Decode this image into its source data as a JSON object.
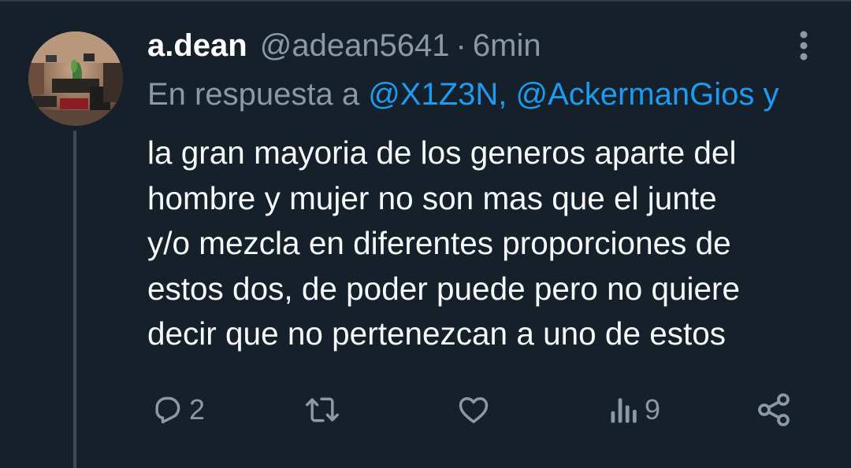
{
  "tweet": {
    "display_name": "a.dean",
    "handle": "@adean5641",
    "separator": "·",
    "time": "6min",
    "reply_prefix": "En respuesta a",
    "reply_mentions": "@X1Z3N, @AckermanGios y ",
    "body_lines": [
      "la gran mayoria de los generos aparte del",
      "hombre y mujer no son mas que el junte",
      "y/o mezcla en diferentes proporciones de",
      "estos dos, de poder puede pero no quiere",
      "decir que no pertenezcan a uno de estos"
    ]
  },
  "actions": {
    "reply_count": "2",
    "retweet_count": "",
    "like_count": "",
    "views_count": "9"
  },
  "icons": {
    "reply": "reply-icon",
    "retweet": "retweet-icon",
    "like": "heart-icon",
    "views": "views-icon",
    "share": "share-icon",
    "more": "more-vertical-icon"
  },
  "colors": {
    "background": "#15202b",
    "text": "#f7f9f9",
    "muted": "#8b98a5",
    "link": "#1d9bf0"
  }
}
